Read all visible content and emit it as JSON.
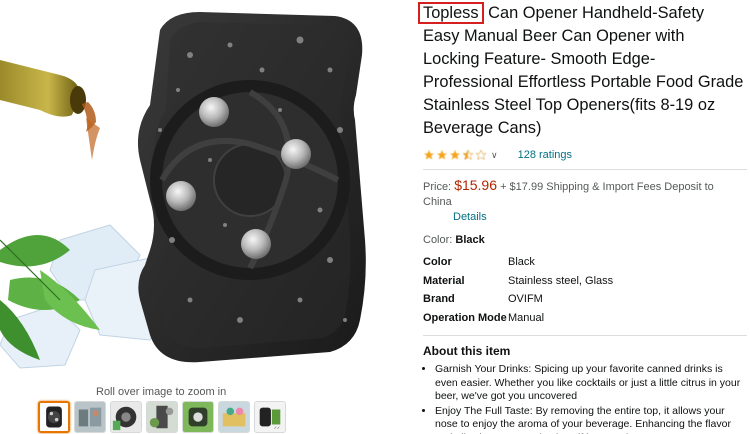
{
  "gallery": {
    "zoom_hint": "Roll over image to zoom in",
    "thumbnails": [
      {
        "name": "thumb-1",
        "selected": true
      },
      {
        "name": "thumb-2",
        "selected": false
      },
      {
        "name": "thumb-3",
        "selected": false
      },
      {
        "name": "thumb-4",
        "selected": false
      },
      {
        "name": "thumb-5",
        "selected": false
      },
      {
        "name": "thumb-6",
        "selected": false
      },
      {
        "name": "thumb-7",
        "selected": false
      }
    ]
  },
  "product": {
    "title_highlight": "Topless",
    "title_rest": " Can Opener Handheld-Safety Easy Manual Beer Can Opener with Locking Feature- Smooth Edge-Professional Effortless Portable Food Grade Stainless Steel Top Openers(fits 8-19 oz Beverage Cans)",
    "rating_stars": 3.5,
    "ratings_count": "128 ratings",
    "price_label": "Price:",
    "price": "$15.96",
    "shipping": "+ $17.99 Shipping & Import Fees Deposit to China",
    "details_link": "Details",
    "color_label": "Color:",
    "color_value": "Black",
    "specs": [
      {
        "key": "Color",
        "value": "Black"
      },
      {
        "key": "Material",
        "value": "Stainless steel, Glass"
      },
      {
        "key": "Brand",
        "value": "OVIFM"
      },
      {
        "key": "Operation Mode",
        "value": "Manual"
      }
    ],
    "about_title": "About this item",
    "bullets": [
      "Garnish Your Drinks: Spicing up your favorite canned drinks is even easier. Whether you like cocktails or just a little citrus in your beer, we've got you uncovered",
      "Enjoy The Full Taste: By removing the entire top, it allows your nose to enjoy the aroma of your beverage. Enhancing the flavor and allowing you to enjoy it as if it were glass"
    ]
  },
  "colors": {
    "price": "#B12704",
    "link": "#007185",
    "star": "#F4A41C",
    "highlight_border": "#D62020",
    "selected_thumb": "#E77600"
  }
}
